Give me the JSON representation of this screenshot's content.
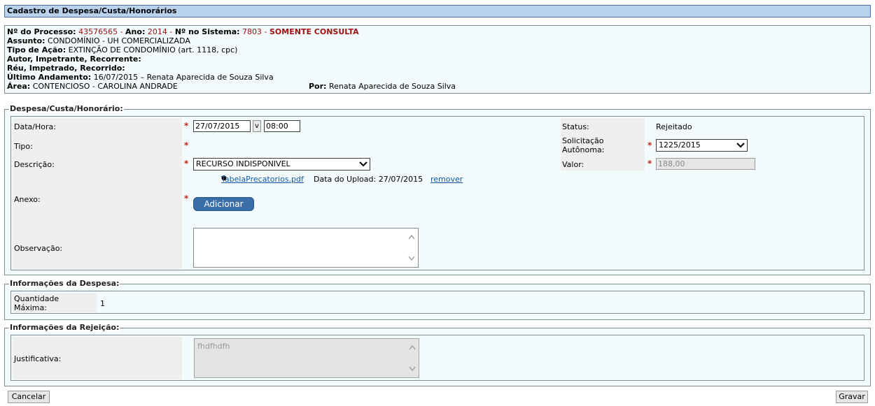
{
  "window_title": "Cadastro de Despesa/Custa/Honorários",
  "process": {
    "processo_label": "Nº do Processo:",
    "processo_value": "43576565",
    "sep1": " - ",
    "ano_label": "Ano:",
    "ano_value": "2014",
    "sep2": " - ",
    "sistema_label": "Nº no Sistema:",
    "sistema_value": "7803",
    "sep3": " - ",
    "mode": "SOMENTE CONSULTA",
    "assunto_label": "Assunto:",
    "assunto_value": "CONDOMÍNIO - UH COMERCIALIZADA",
    "tipo_acao_label": "Tipo de Ação:",
    "tipo_acao_value": "EXTINÇÃO DE CONDOMÍNIO (art. 1118, cpc)",
    "autor_label": "Autor, Impetrante, Recorrente:",
    "reu_label": "Réu, Impetrado, Recorrido:",
    "andamento_label": "Último Andamento:",
    "andamento_value": "16/07/2015 – Renata Aparecida de Souza Silva",
    "area_label": "Área:",
    "area_value": "CONTENCIOSO - CAROLINA ANDRADE",
    "por_label": "Por:",
    "por_value": "Renata Aparecida de Souza Silva"
  },
  "despesa": {
    "legend": "Despesa/Custa/Honorário:",
    "data_hora_label": "Data/Hora:",
    "date_value": "27/07/2015",
    "date_btn": "v",
    "time_value": "08:00",
    "tipo_label": "Tipo:",
    "descricao_label": "Descrição:",
    "descricao_value": "RECURSO INDISPONIVEL",
    "anexo_label": "Anexo:",
    "file_name": "TabelaPrecatorios.pdf",
    "upload_info": "Data do Upload: 27/07/2015",
    "remove_link": "remover",
    "add_button": "Adicionar",
    "observacao_label": "Observação:",
    "observacao_value": "",
    "status_label": "Status:",
    "status_value": "Rejeitado",
    "solicitacao_label_1": "Solicitação",
    "solicitacao_label_2": "Autônoma:",
    "solicitacao_value": "1225/2015",
    "valor_label": "Valor:",
    "valor_value": "188,00",
    "required_marker": "*"
  },
  "info_despesa": {
    "legend": "Informações da Despesa:",
    "quantidade_label_1": "Quantidade",
    "quantidade_label_2": "Máxima:",
    "quantidade_value": "1"
  },
  "rejeicao": {
    "legend": "Informações da Rejeição:",
    "justificativa_label": "Justificativa:",
    "justificativa_value": "fhdfhdfh"
  },
  "footer": {
    "cancel_button": "Cancelar",
    "save_button": "Gravar"
  },
  "icons": {
    "dropdown": "chevron-down-icon",
    "scroll_up": "chevron-up-icon",
    "scroll_down": "chevron-down-icon",
    "bullet": "bullet-icon"
  },
  "colors": {
    "title_bg": "#b9d3ef",
    "panel_bg": "#f3fbfc",
    "accent_red": "#a01212",
    "link_blue": "#1358a5",
    "button_blue": "#3a6ea8"
  }
}
